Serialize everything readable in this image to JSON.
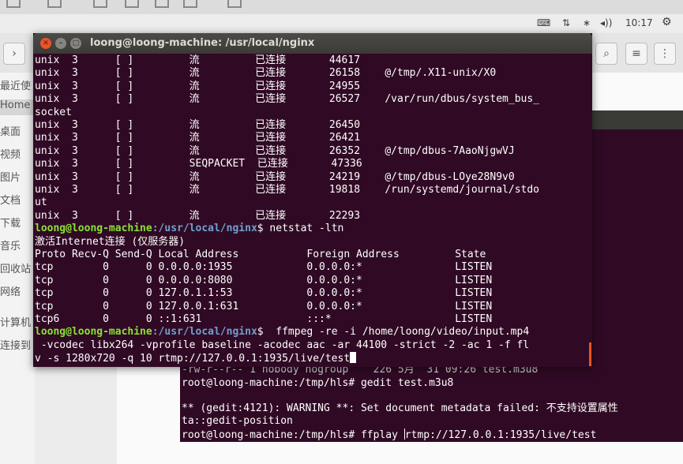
{
  "panel": {
    "keyboard_label": "⌨",
    "network_label": "⇅",
    "bluetooth_label": "∗",
    "volume_label": "◂))",
    "time": "10:17",
    "settings_label": "⚙"
  },
  "file_manager": {
    "toolbar": {
      "forward_label": "›",
      "search_label": "⌕",
      "view_label": "≡",
      "more_label": "⋮"
    },
    "sidebar": [
      "最近使",
      "Home",
      "桌面",
      "视频",
      "图片",
      "文档",
      "下载",
      "音乐",
      "回收站",
      "网络",
      "计算机",
      "连接到"
    ]
  },
  "terminal": {
    "title": "loong@loong-machine: /usr/local/nginx",
    "close_label": "✕",
    "min_label": "–",
    "max_label": "□",
    "prompt_user": "loong@loong-machine",
    "prompt_path": ":/usr/local/nginx",
    "lines": {
      "l1": "unix  3      [ ]         流         已连接       44617",
      "l2": "unix  3      [ ]         流         已连接       26158    @/tmp/.X11-unix/X0",
      "l3": "unix  3      [ ]         流         已连接       24955",
      "l4": "unix  3      [ ]         流         已连接       26527    /var/run/dbus/system_bus_",
      "l5": "socket",
      "l6": "unix  3      [ ]         流         已连接       26450",
      "l7": "unix  3      [ ]         流         已连接       26421",
      "l8": "unix  3      [ ]         流         已连接       26352    @/tmp/dbus-7AaoNjgwVJ",
      "l9": "unix  3      [ ]         SEQPACKET  已连接       47336",
      "l10": "unix  3      [ ]         流         已连接       24219    @/tmp/dbus-LOye28N9v0",
      "l11": "unix  3      [ ]         流         已连接       19818    /run/systemd/journal/stdo",
      "l12": "ut",
      "l13": "unix  3      [ ]         流         已连接       22293",
      "cmd1": "$ netstat -ltn",
      "l15": "激活Internet连接 (仅服务器)",
      "l16": "Proto Recv-Q Send-Q Local Address           Foreign Address         State",
      "l17": "tcp        0      0 0.0.0.0:1935            0.0.0.0:*               LISTEN",
      "l18": "tcp        0      0 0.0.0.0:8080            0.0.0.0:*               LISTEN",
      "l19": "tcp        0      0 127.0.1.1:53            0.0.0.0:*               LISTEN",
      "l20": "tcp        0      0 127.0.0.1:631           0.0.0.0:*               LISTEN",
      "l21": "tcp6       0      0 ::1:631                 :::*                    LISTEN",
      "cmd2": "$  ffmpeg -re -i /home/loong/video/input.mp4",
      "l23": " -vcodec libx264 -vprofile baseline -acodec aac -ar 44100 -strict -2 -ac 1 -f fl",
      "l24": "v -s 1280x720 -q 10 rtmp://127.0.0.1:1935/live/test"
    }
  },
  "terminal2": {
    "lines": {
      "l1": "-rw-r--r-- 1 nobody nogroup    226 5月  31 09:26 test.m3u8",
      "l2": "root@loong-machine:/tmp/hls# gedit test.m3u8",
      "l3": "",
      "l4": "** (gedit:4121): WARNING **: Set document metadata failed: 不支持设置属性",
      "l5": "ta::gedit-position",
      "l6a": "root@loong-machine:/tmp/hls# ffplay ",
      "l6b": "rtmp://127.0.0.1:1935/live/test"
    }
  }
}
